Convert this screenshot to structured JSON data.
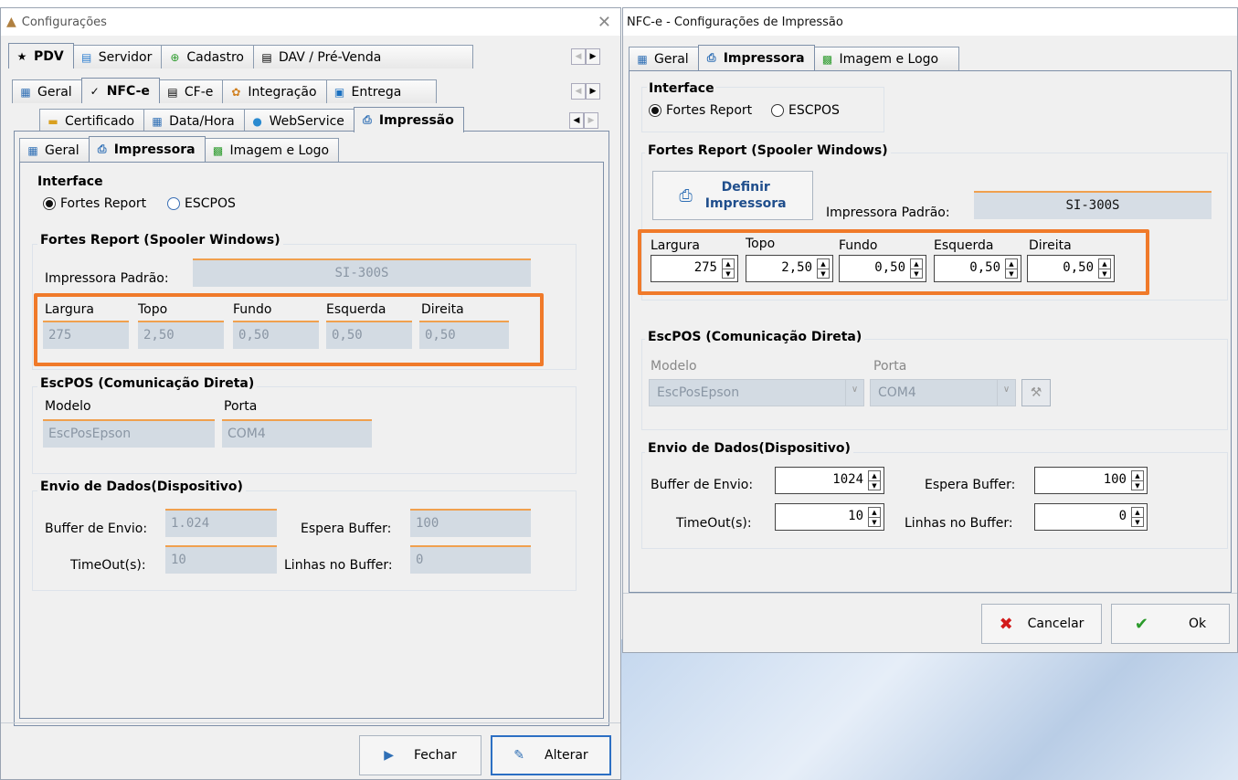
{
  "left_window": {
    "title": "Configurações",
    "main_tabs": [
      "PDV",
      "Servidor",
      "Cadastro",
      "DAV / Pré-Venda"
    ],
    "sub_tabs": [
      "Geral",
      "NFC-e",
      "CF-e",
      "Integração",
      "Entrega"
    ],
    "nfce_tabs": [
      "Certificado",
      "Data/Hora",
      "WebService",
      "Impressão"
    ],
    "print_tabs": [
      "Geral",
      "Impressora",
      "Imagem e Logo"
    ],
    "interface_title": "Interface",
    "radio_fortes": "Fortes Report",
    "radio_escpos": "ESCPOS",
    "fortes_title": "Fortes Report (Spooler Windows)",
    "impressora_label": "Impressora Padrão:",
    "impressora_value": "SI-300S",
    "margins": [
      {
        "label": "Largura",
        "value": "275"
      },
      {
        "label": "Topo",
        "value": "2,50"
      },
      {
        "label": "Fundo",
        "value": "0,50"
      },
      {
        "label": "Esquerda",
        "value": "0,50"
      },
      {
        "label": "Direita",
        "value": "0,50"
      }
    ],
    "escpos_title": "EscPOS (Comunicação Direta)",
    "modelo_label": "Modelo",
    "modelo_value": "EscPosEpson",
    "porta_label": "Porta",
    "porta_value": "COM4",
    "envio_title": "Envio de Dados(Dispositivo)",
    "buffer_label": "Buffer de Envio:",
    "buffer_value": "1.024",
    "espera_label": "Espera Buffer:",
    "espera_value": "100",
    "timeout_label": "TimeOut(s):",
    "timeout_value": "10",
    "linhas_label": "Linhas no Buffer:",
    "linhas_value": "0",
    "fechar_label": "Fechar",
    "alterar_label": "Alterar"
  },
  "right_window": {
    "title": "NFC-e - Configurações de Impressão",
    "tabs": [
      "Geral",
      "Impressora",
      "Imagem e Logo"
    ],
    "interface_title": "Interface",
    "radio_fortes": "Fortes Report",
    "radio_escpos": "ESCPOS",
    "fortes_title": "Fortes Report (Spooler Windows)",
    "definir_line1": "Definir",
    "definir_line2": "Impressora",
    "impressora_label": "Impressora Padrão:",
    "impressora_value": "SI-300S",
    "margins": [
      {
        "label": "Largura",
        "value": "275"
      },
      {
        "label": "Topo",
        "value": "2,50"
      },
      {
        "label": "Fundo",
        "value": "0,50"
      },
      {
        "label": "Esquerda",
        "value": "0,50"
      },
      {
        "label": "Direita",
        "value": "0,50"
      }
    ],
    "escpos_title": "EscPOS (Comunicação Direta)",
    "modelo_label": "Modelo",
    "modelo_value": "EscPosEpson",
    "porta_label": "Porta",
    "porta_value": "COM4",
    "envio_title": "Envio de Dados(Dispositivo)",
    "buffer_label": "Buffer de Envio:",
    "buffer_value": "1024",
    "espera_label": "Espera Buffer:",
    "espera_value": "100",
    "timeout_label": "TimeOut(s):",
    "timeout_value": "10",
    "linhas_label": "Linhas no Buffer:",
    "linhas_value": "0",
    "cancelar_label": "Cancelar",
    "ok_label": "Ok"
  },
  "colors": {
    "highlight": "#f07a2a",
    "field_bg": "#d3dbe3",
    "field_border": "#f0a04e"
  }
}
